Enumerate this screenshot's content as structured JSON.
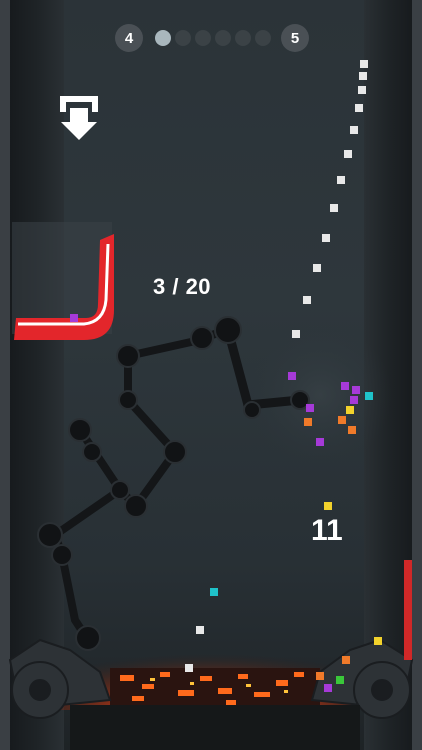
{
  "hud": {
    "current_level": "4",
    "next_level": "5",
    "progress": {
      "segments": 6,
      "filled": 1
    },
    "collected_counter": "3 / 20",
    "balls_remaining": "11"
  },
  "icons": {
    "drop_button": "drop-arrow-icon",
    "container": "collector-cup",
    "hazard": "lava-pit",
    "crushers": "gear-crusher"
  },
  "colors": {
    "cup_red": "#e3262b",
    "lava": "#ff5a1a",
    "cube_purple": "#a63ad8",
    "cube_orange": "#f07a2a",
    "cube_yellow": "#f2d22c",
    "cube_teal": "#1fc2c9",
    "cube_white": "#e8e8e8",
    "cube_green": "#3ac73a"
  }
}
